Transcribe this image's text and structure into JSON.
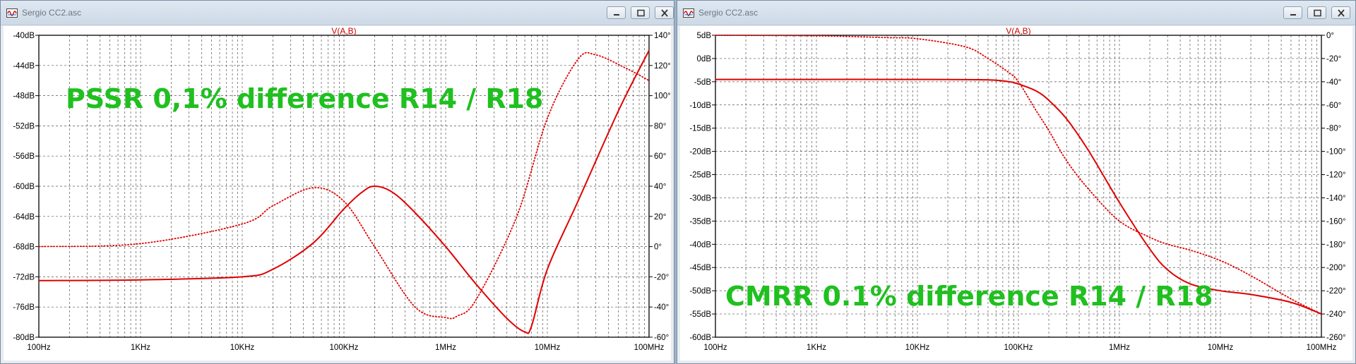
{
  "windows": [
    {
      "title": "Sergio CC2.asc",
      "chart_data": {
        "type": "line",
        "title": "V(A,B)",
        "annotation": "PSSR 0,1% difference R14 / R18",
        "x_scale": "log",
        "xlim": [
          100,
          100000000
        ],
        "x_ticks": [
          100,
          1000,
          10000,
          100000,
          1000000,
          10000000,
          100000000
        ],
        "x_tick_labels": [
          "100Hz",
          "1KHz",
          "10KHz",
          "100KHz",
          "1MHz",
          "10MHz",
          "100MHz"
        ],
        "ylim_left": [
          -80,
          -40
        ],
        "y_left_ticks": [
          -40,
          -44,
          -48,
          -52,
          -56,
          -60,
          -64,
          -68,
          -72,
          -76,
          -80
        ],
        "y_left_tick_labels": [
          "-40dB",
          "-44dB",
          "-48dB",
          "-52dB",
          "-56dB",
          "-60dB",
          "-64dB",
          "-68dB",
          "-72dB",
          "-76dB",
          "-80dB"
        ],
        "ylim_right": [
          -60,
          140
        ],
        "y_right_ticks": [
          140,
          120,
          100,
          80,
          60,
          40,
          20,
          0,
          -20,
          -40,
          -60
        ],
        "y_right_tick_labels": [
          "140°",
          "120°",
          "100°",
          "80°",
          "60°",
          "40°",
          "20°",
          "0°",
          "-20°",
          "-40°",
          "-60°"
        ],
        "grid": true,
        "series": [
          {
            "kind": "magnitude",
            "axis": "left",
            "style": "solid",
            "color": "#e00000",
            "x": [
              100,
              1000,
              10000,
              20000,
              50000,
              100000,
              150000,
              200000,
              300000,
              500000,
              1000000,
              2000000,
              4000000,
              6000000,
              7000000,
              10000000,
              20000000,
              50000000,
              100000000
            ],
            "y": [
              -72.5,
              -72.4,
              -72.0,
              -71.0,
              -67.5,
              -63.0,
              -60.8,
              -60.0,
              -60.8,
              -63.5,
              -68.0,
              -73.0,
              -77.5,
              -79.3,
              -78.5,
              -71.0,
              -62.0,
              -50.0,
              -42.0
            ]
          },
          {
            "kind": "phase",
            "axis": "right",
            "style": "dotted",
            "color": "#e00000",
            "x": [
              100,
              1000,
              10000,
              20000,
              50000,
              100000,
              200000,
              500000,
              1000000,
              1300000,
              2000000,
              5000000,
              10000000,
              20000000,
              30000000,
              60000000,
              100000000
            ],
            "y": [
              0,
              2,
              15,
              27,
              39,
              30,
              0,
              -40,
              -47,
              -46,
              -35,
              20,
              85,
              124,
              127,
              118,
              110
            ]
          }
        ]
      }
    },
    {
      "title": "Sergio CC2.asc",
      "chart_data": {
        "type": "line",
        "title": "V(A,B)",
        "annotation": "CMRR 0.1% difference R14 / R18",
        "x_scale": "log",
        "xlim": [
          100,
          100000000
        ],
        "x_ticks": [
          100,
          1000,
          10000,
          100000,
          1000000,
          10000000,
          100000000
        ],
        "x_tick_labels": [
          "100Hz",
          "1KHz",
          "10KHz",
          "100KHz",
          "1MHz",
          "10MHz",
          "100MHz"
        ],
        "ylim_left": [
          -60,
          5
        ],
        "y_left_ticks": [
          5,
          0,
          -5,
          -10,
          -15,
          -20,
          -25,
          -30,
          -35,
          -40,
          -45,
          -50,
          -55,
          -60
        ],
        "y_left_tick_labels": [
          "5dB",
          "0dB",
          "-5dB",
          "-10dB",
          "-15dB",
          "-20dB",
          "-25dB",
          "-30dB",
          "-35dB",
          "-40dB",
          "-45dB",
          "-50dB",
          "-55dB",
          "-60dB"
        ],
        "ylim_right": [
          -260,
          0
        ],
        "y_right_ticks": [
          0,
          -20,
          -40,
          -60,
          -80,
          -100,
          -120,
          -140,
          -160,
          -180,
          -200,
          -220,
          -240,
          -260
        ],
        "y_right_tick_labels": [
          "0°",
          "-20°",
          "-40°",
          "-60°",
          "-80°",
          "-100°",
          "-120°",
          "-140°",
          "-160°",
          "-180°",
          "-200°",
          "-220°",
          "-240°",
          "-260°"
        ],
        "grid": true,
        "series": [
          {
            "kind": "magnitude",
            "axis": "left",
            "style": "solid",
            "color": "#e00000",
            "x": [
              100,
              1000,
              10000,
              50000,
              80000,
              100000,
              150000,
              200000,
              300000,
              500000,
              1000000,
              2000000,
              3000000,
              5000000,
              10000000,
              20000000,
              50000000,
              100000000
            ],
            "y": [
              -4.5,
              -4.5,
              -4.5,
              -4.6,
              -5.0,
              -5.5,
              -7.0,
              -9.0,
              -13.0,
              -20.0,
              -31.0,
              -41.0,
              -45.5,
              -48.5,
              -50.0,
              -50.8,
              -52.5,
              -55.0
            ]
          },
          {
            "kind": "phase",
            "axis": "right",
            "style": "dotted",
            "color": "#e00000",
            "x": [
              100,
              1000,
              5000,
              10000,
              30000,
              50000,
              80000,
              100000,
              150000,
              200000,
              300000,
              500000,
              1000000,
              2000000,
              3000000,
              5000000,
              10000000,
              20000000,
              50000000,
              100000000
            ],
            "y": [
              0,
              -0.5,
              -2,
              -3,
              -10,
              -20,
              -32,
              -40,
              -65,
              -82,
              -108,
              -133,
              -160,
              -174,
              -180,
              -185,
              -194,
              -207,
              -227,
              -240
            ]
          }
        ]
      }
    }
  ]
}
